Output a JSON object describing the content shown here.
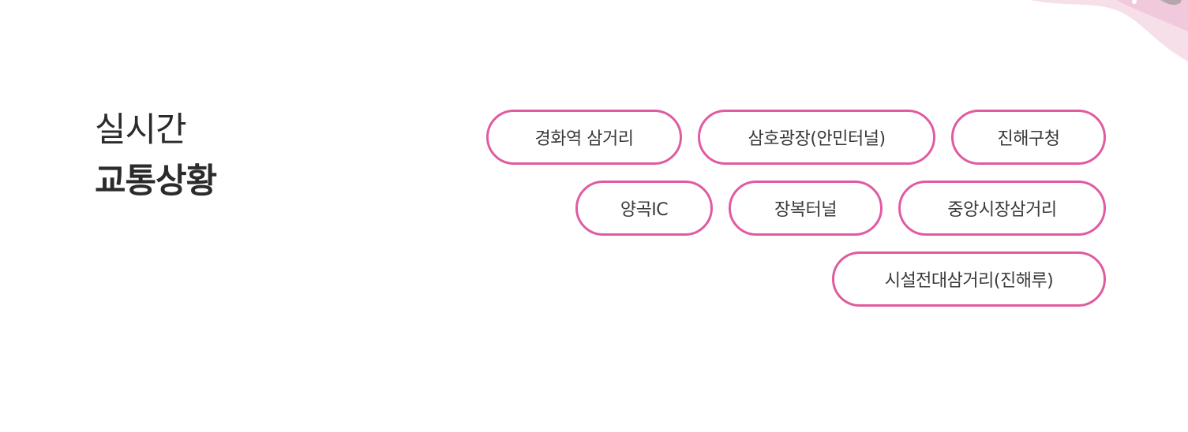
{
  "heading": {
    "line1": "실시간",
    "line2": "교통상황"
  },
  "locations": [
    "경화역 삼거리",
    "삼호광장(안민터널)",
    "진해구청",
    "양곡IC",
    "장복터널",
    "중앙시장삼거리",
    "시설전대삼거리(진해루)"
  ],
  "colors": {
    "pill_border": "#e05ba0",
    "text": "#3a3a3a",
    "heading": "#2b2b2b",
    "decoration": "#f3d6e4"
  }
}
